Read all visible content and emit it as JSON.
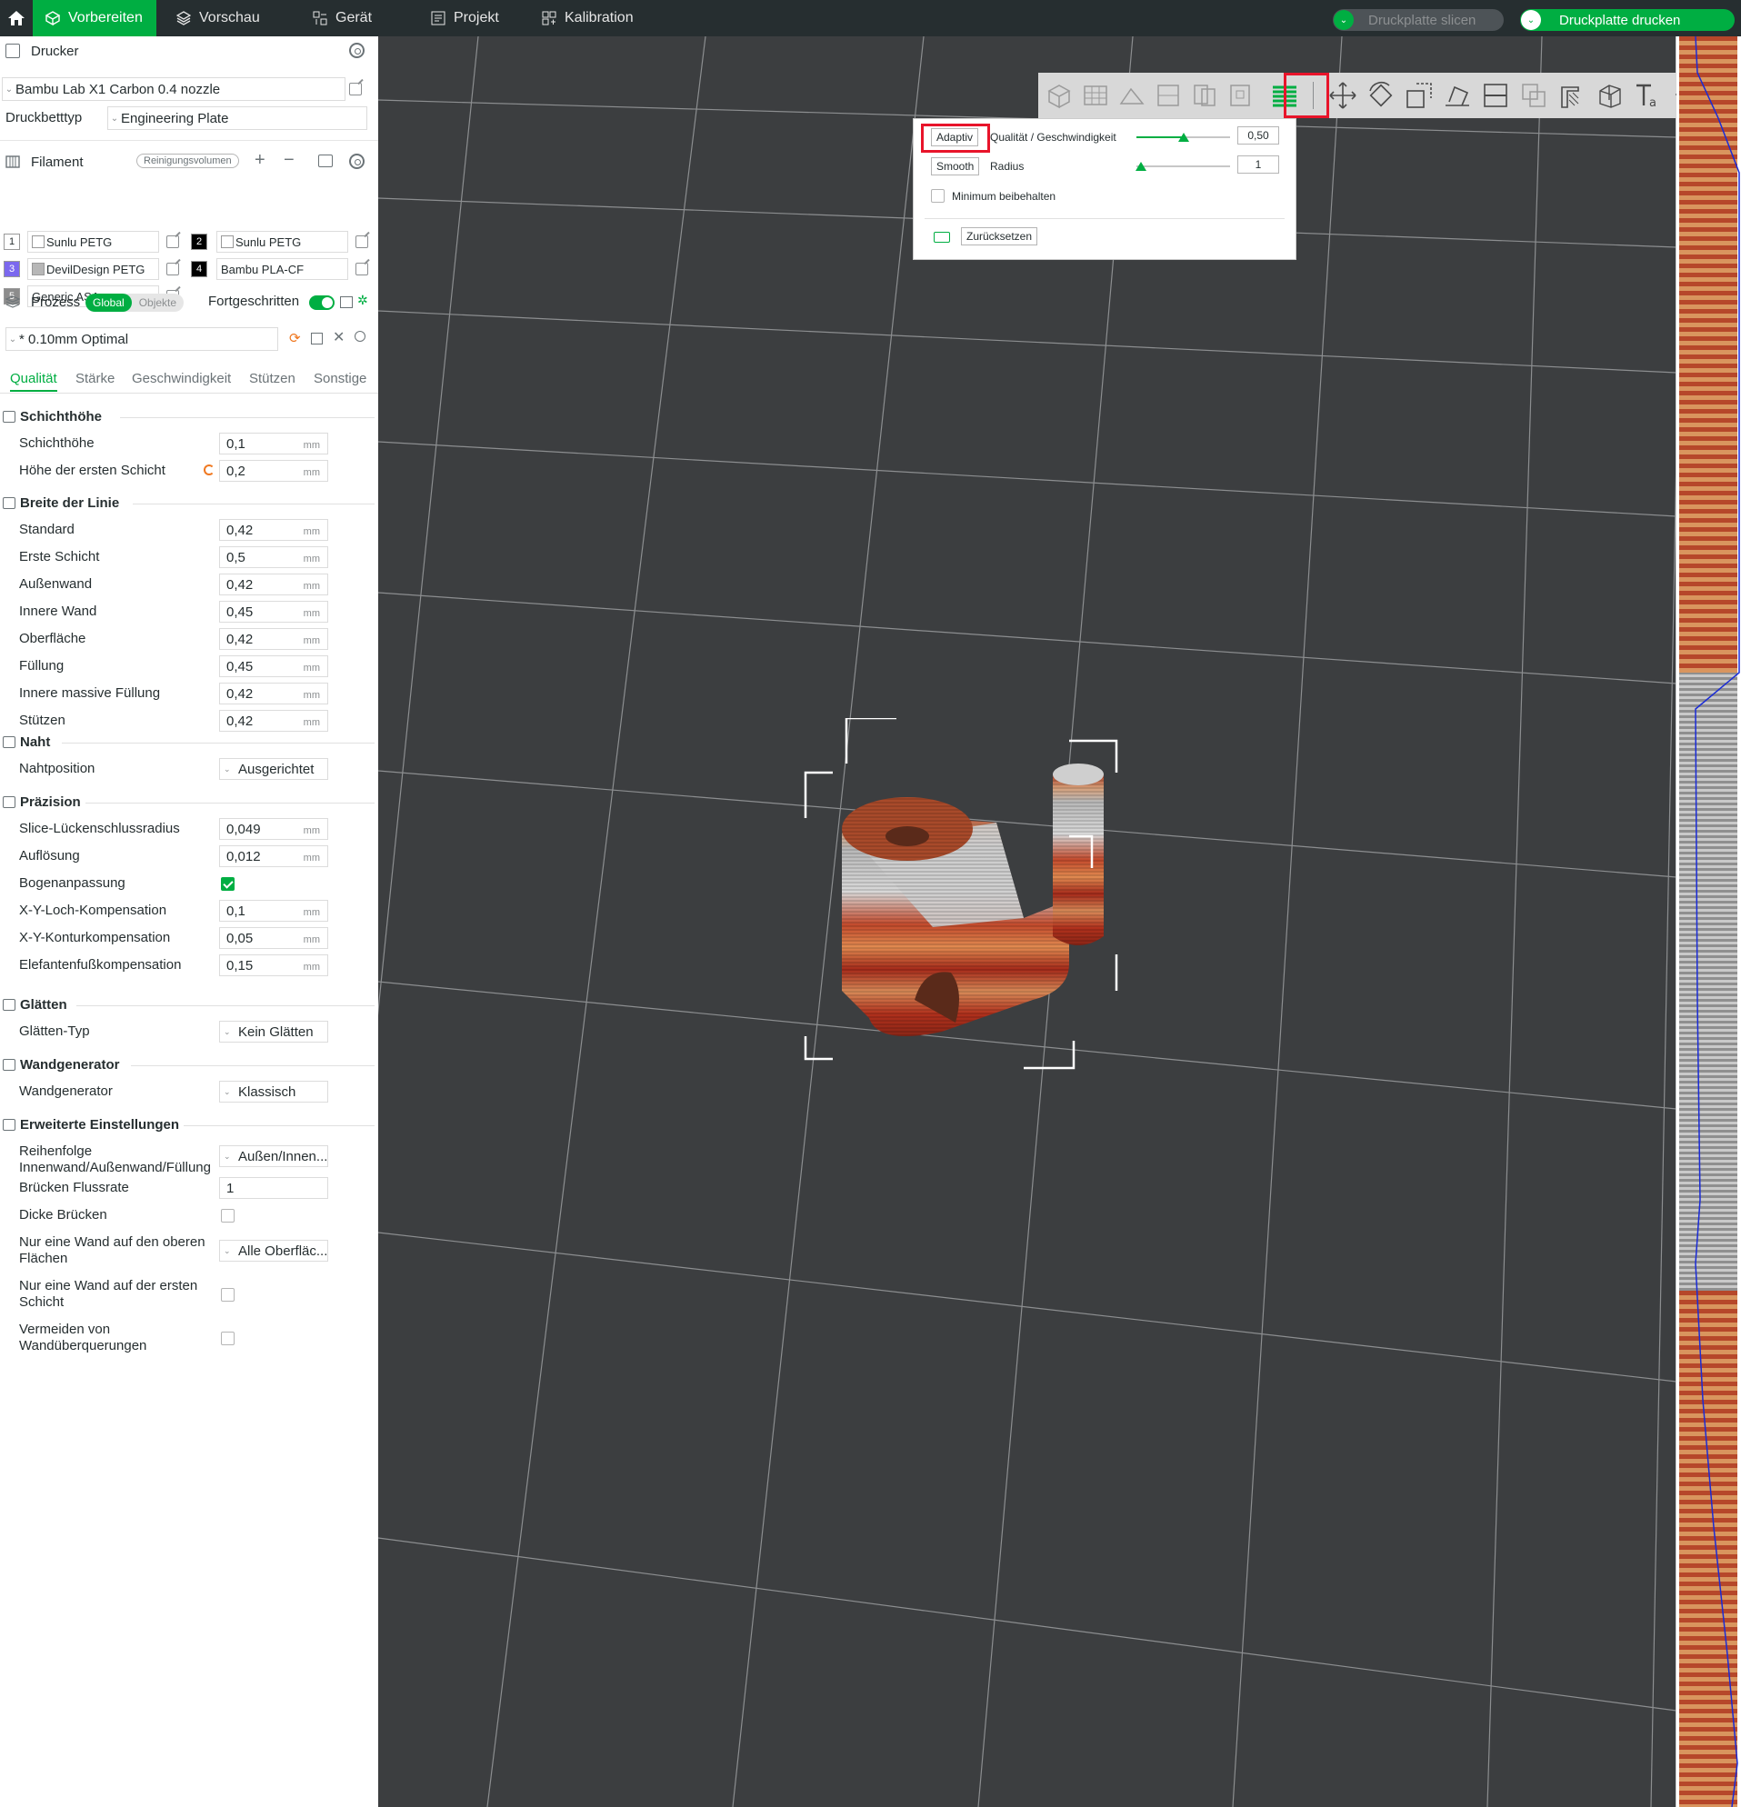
{
  "topbar": {
    "tabs": [
      {
        "label": "Vorbereiten",
        "icon": "prepare-cube-icon",
        "active": true
      },
      {
        "label": "Vorschau",
        "icon": "layers-icon"
      },
      {
        "label": "Gerät",
        "icon": "device-icon"
      },
      {
        "label": "Projekt",
        "icon": "project-icon"
      },
      {
        "label": "Kalibration",
        "icon": "calibration-icon"
      }
    ],
    "slice_button": "Druckplatte slicen",
    "print_button": "Druckplatte drucken"
  },
  "printer": {
    "section_label": "Drucker",
    "model": "Bambu Lab X1 Carbon 0.4 nozzle",
    "bed_type_label": "Druckbetttyp",
    "bed_type": "Engineering Plate"
  },
  "filament": {
    "section_label": "Filament",
    "flush_label": "Reinigungsvolumen",
    "items": [
      {
        "num": "1",
        "name": "Sunlu PETG",
        "color": "#ffffff",
        "num_bg": "#ffffff",
        "num_fg": "#262e30"
      },
      {
        "num": "2",
        "name": "Sunlu PETG",
        "color": "#ffffff",
        "num_bg": "#000000",
        "num_fg": "#ffffff"
      },
      {
        "num": "3",
        "name": "DevilDesign PETG",
        "color": "#b7b7b7",
        "num_bg": "#7b68ee",
        "num_fg": "#ffffff"
      },
      {
        "num": "4",
        "name": "Bambu PLA-CF",
        "color": "#000000",
        "num_bg": "#000000",
        "num_fg": "#ffffff"
      },
      {
        "num": "5",
        "name": "Generic ASA",
        "color": "#8c8c8c",
        "num_bg": "#8c8c8c",
        "num_fg": "#ffffff"
      }
    ]
  },
  "process": {
    "section_label": "Prozess",
    "global_label": "Global",
    "objects_label": "Objekte",
    "advanced_label": "Fortgeschritten",
    "profile": "* 0.10mm Optimal",
    "tabs": [
      "Qualität",
      "Stärke",
      "Geschwindigkeit",
      "Stützen",
      "Sonstige"
    ]
  },
  "sections": {
    "layer_height": {
      "title": "Schichthöhe",
      "rows": [
        {
          "label": "Schichthöhe",
          "value": "0,1",
          "unit": "mm"
        },
        {
          "label": "Höhe der ersten Schicht",
          "value": "0,2",
          "unit": "mm"
        }
      ]
    },
    "line_width": {
      "title": "Breite der Linie",
      "rows": [
        {
          "label": "Standard",
          "value": "0,42",
          "unit": "mm"
        },
        {
          "label": "Erste Schicht",
          "value": "0,5",
          "unit": "mm"
        },
        {
          "label": "Außenwand",
          "value": "0,42",
          "unit": "mm"
        },
        {
          "label": "Innere Wand",
          "value": "0,45",
          "unit": "mm"
        },
        {
          "label": "Oberfläche",
          "value": "0,42",
          "unit": "mm"
        },
        {
          "label": "Füllung",
          "value": "0,45",
          "unit": "mm"
        },
        {
          "label": "Innere massive Füllung",
          "value": "0,42",
          "unit": "mm"
        },
        {
          "label": "Stützen",
          "value": "0,42",
          "unit": "mm"
        }
      ]
    },
    "seam": {
      "title": "Naht",
      "rows": [
        {
          "label": "Nahtposition",
          "value": "Ausgerichtet"
        }
      ]
    },
    "precision": {
      "title": "Präzision",
      "rows": [
        {
          "label": "Slice-Lückenschlussradius",
          "value": "0,049",
          "unit": "mm"
        },
        {
          "label": "Auflösung",
          "value": "0,012",
          "unit": "mm"
        },
        {
          "label": "Bogenanpassung",
          "checked": true
        },
        {
          "label": "X-Y-Loch-Kompensation",
          "value": "0,1",
          "unit": "mm"
        },
        {
          "label": "X-Y-Konturkompensation",
          "value": "0,05",
          "unit": "mm"
        },
        {
          "label": "Elefantenfußkompensation",
          "value": "0,15",
          "unit": "mm"
        }
      ]
    },
    "ironing": {
      "title": "Glätten",
      "rows": [
        {
          "label": "Glätten-Typ",
          "value": "Kein Glätten"
        }
      ]
    },
    "wall_gen": {
      "title": "Wandgenerator",
      "rows": [
        {
          "label": "Wandgenerator",
          "value": "Klassisch"
        }
      ]
    },
    "advanced": {
      "title": "Erweiterte Einstellungen",
      "rows": [
        {
          "label": "Reihenfolge Innenwand/Außenwand/Füllung",
          "value": "Außen/Innen..."
        },
        {
          "label": "Brücken Flussrate",
          "value": "1"
        },
        {
          "label": "Dicke Brücken",
          "checked": false
        },
        {
          "label": "Nur eine Wand auf den oberen Flächen",
          "value": "Alle Oberfläc..."
        },
        {
          "label": "Nur eine Wand auf der ersten Schicht",
          "checked": false
        },
        {
          "label": "Vermeiden von Wandüberquerungen",
          "checked": false
        }
      ]
    }
  },
  "adaptive_popup": {
    "adaptive_button": "Adaptiv",
    "quality_speed_label": "Qualität / Geschwindigkeit",
    "quality_speed_value": "0,50",
    "quality_speed_level": 0.5,
    "smooth_button": "Smooth",
    "radius_label": "Radius",
    "radius_value": "1",
    "keep_min_label": "Minimum beibehalten",
    "reset_button": "Zurücksetzen"
  },
  "colors": {
    "accent": "#00ae42",
    "highlight": "#e8142a",
    "topbar": "#262e30",
    "viewport": "#3c3e40"
  }
}
